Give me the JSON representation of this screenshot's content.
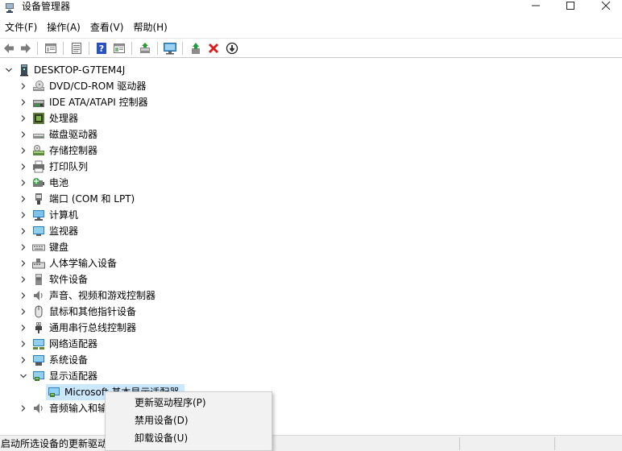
{
  "window": {
    "title": "设备管理器",
    "controls": {
      "minimize": "—",
      "maximize": "☐",
      "close": "✕"
    }
  },
  "menu": [
    "文件(F)",
    "操作(A)",
    "查看(V)",
    "帮助(H)"
  ],
  "toolbar": {
    "buttons": [
      "back-icon",
      "forward-icon",
      "properties-icon",
      "list-view-icon",
      "help-icon",
      "details-view-icon",
      "update-driver-icon",
      "monitor-scan-icon",
      "enable-device-icon",
      "uninstall-icon",
      "disable-device-icon"
    ],
    "colors": {
      "enable": "#1e9e3c",
      "uninstall": "#d81e1e"
    }
  },
  "tree": {
    "root": "DESKTOP-G7TEM4J",
    "categories": [
      {
        "label": "DVD/CD-ROM 驱动器",
        "icon": "dvd-drive-icon"
      },
      {
        "label": "IDE ATA/ATAPI 控制器",
        "icon": "ide-controller-icon"
      },
      {
        "label": "处理器",
        "icon": "processor-icon"
      },
      {
        "label": "磁盘驱动器",
        "icon": "disk-drive-icon"
      },
      {
        "label": "存储控制器",
        "icon": "storage-controller-icon"
      },
      {
        "label": "打印队列",
        "icon": "printer-icon"
      },
      {
        "label": "电池",
        "icon": "battery-icon"
      },
      {
        "label": "端口 (COM 和 LPT)",
        "icon": "port-icon"
      },
      {
        "label": "计算机",
        "icon": "computer-icon"
      },
      {
        "label": "监视器",
        "icon": "monitor-icon"
      },
      {
        "label": "键盘",
        "icon": "keyboard-icon"
      },
      {
        "label": "人体学输入设备",
        "icon": "hid-icon"
      },
      {
        "label": "软件设备",
        "icon": "software-device-icon"
      },
      {
        "label": "声音、视频和游戏控制器",
        "icon": "sound-icon"
      },
      {
        "label": "鼠标和其他指针设备",
        "icon": "mouse-icon"
      },
      {
        "label": "通用串行总线控制器",
        "icon": "usb-icon"
      },
      {
        "label": "网络适配器",
        "icon": "network-icon"
      },
      {
        "label": "系统设备",
        "icon": "system-device-icon"
      },
      {
        "label": "显示适配器",
        "icon": "display-adapter-icon",
        "expanded": true
      }
    ],
    "child": "Microsoft 基本显示适配器",
    "after_child": {
      "label": "音频输入和输出",
      "icon": "audio-io-icon"
    }
  },
  "context_menu": {
    "items": [
      "更新驱动程序(P)",
      "禁用设备(D)",
      "卸载设备(U)"
    ]
  },
  "status": {
    "text": "启动所选设备的更新驱动"
  }
}
